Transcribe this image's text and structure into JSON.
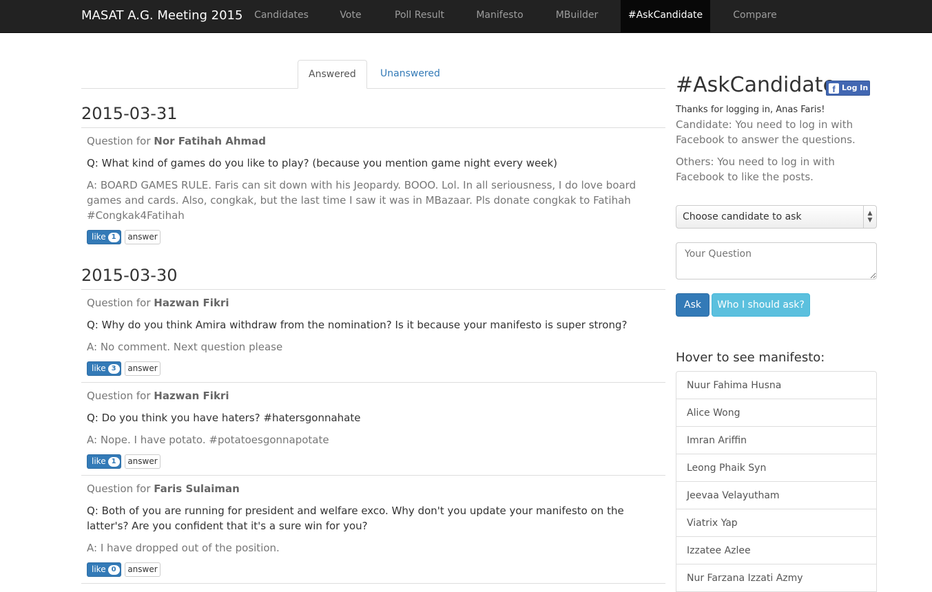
{
  "navbar": {
    "brand": "MASAT A.G. Meeting 2015",
    "links": [
      "Candidates",
      "Vote",
      "Poll Result",
      "Manifesto",
      "MBuilder",
      "#AskCandidate",
      "Compare"
    ],
    "active": "#AskCandidate"
  },
  "tabs": {
    "answered": "Answered",
    "unanswered": "Unanswered"
  },
  "days": [
    {
      "date": "2015-03-31",
      "questions": [
        {
          "prefix": "Question for",
          "candidate": "Nor Fatihah Ahmad",
          "question": "Q: What kind of games do you like to play? (because you mention game night every week)",
          "answer": "A: BOARD GAMES RULE. Faris can sit down with his Jeopardy. BOOO. Lol. In all seriousness, I do love board games and cards. Also, congkak, but the last time I saw it was in MBazaar. Pls donate congkak to Fatihah #Congkak4Fatihah",
          "likes": "1"
        }
      ]
    },
    {
      "date": "2015-03-30",
      "questions": [
        {
          "prefix": "Question for",
          "candidate": "Hazwan Fikri",
          "question": "Q: Why do you think Amira withdraw from the nomination? Is it because your manifesto is super strong?",
          "answer": "A: No comment. Next question please",
          "likes": "3"
        },
        {
          "prefix": "Question for",
          "candidate": "Hazwan Fikri",
          "question": "Q: Do you think you have haters? #hatersgonnahate",
          "answer": "A: Nope. I have potato. #potatoesgonnapotate",
          "likes": "1"
        },
        {
          "prefix": "Question for",
          "candidate": "Faris Sulaiman",
          "question": "Q: Both of you are running for president and welfare exco. Why don't you update your manifesto on the latter's? Are you confident that it's a sure win for you?",
          "answer": "A: I have dropped out of the position.",
          "likes": "0"
        }
      ]
    }
  ],
  "buttons": {
    "like": "like",
    "answer": "answer"
  },
  "sidebar": {
    "title": "#AskCandidate",
    "fb_login": "Log In",
    "fb_logo": "f",
    "thanks": "Thanks for logging in, Anas Faris!",
    "note_candidate": "Candidate: You need to log in with Facebook to answer the questions.",
    "note_others": "Others: You need to log in with Facebook to like the posts.",
    "select_value": "Choose candidate to ask",
    "question_placeholder": "Your Question",
    "ask_label": "Ask",
    "who_label": "Who I should ask?",
    "hover_title": "Hover to see manifesto:",
    "candidates": [
      "Nuur Fahima Husna",
      "Alice Wong",
      "Imran Ariffin",
      "Leong Phaik Syn",
      "Jeevaa Velayutham",
      "Viatrix Yap",
      "Izzatee Azlee",
      "Nur Farzana Izzati Azmy"
    ]
  },
  "colors": {
    "navbar": "#222222",
    "primary": "#337ab7",
    "info": "#5bc0de",
    "facebook": "#4267b2"
  }
}
